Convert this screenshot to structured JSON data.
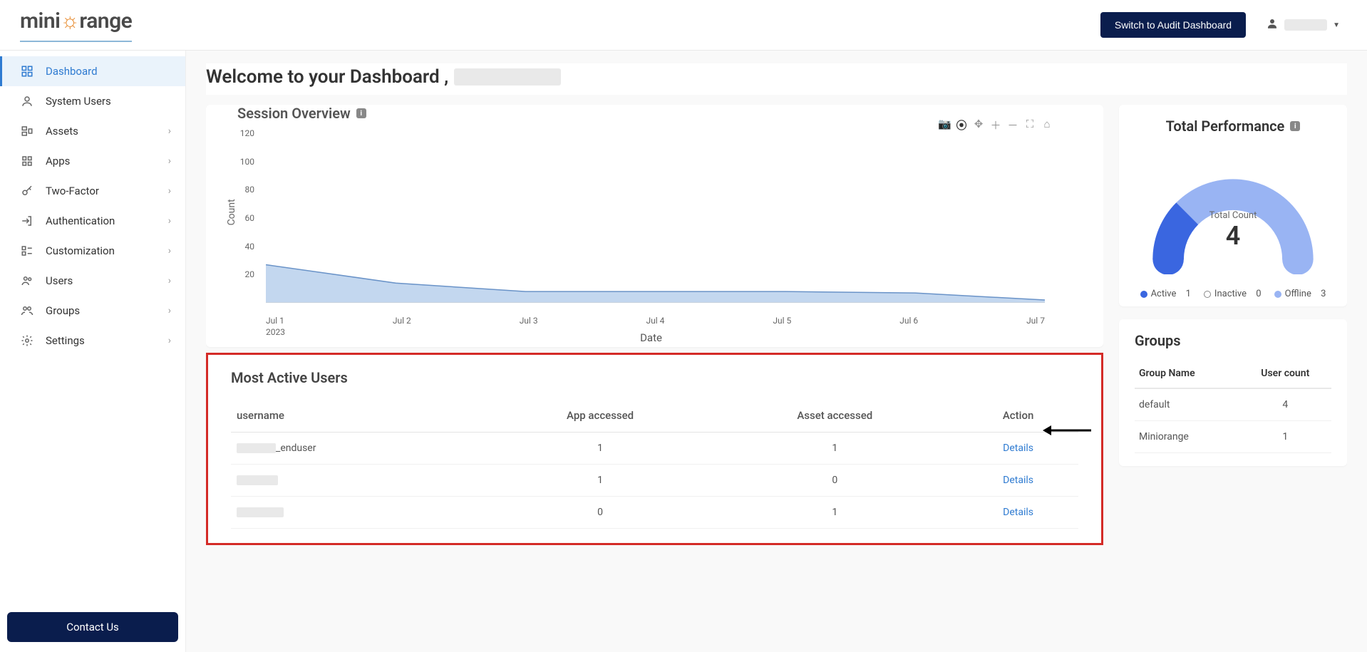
{
  "header": {
    "brand_prefix": "mini",
    "brand_suffix": "range",
    "switch_label": "Switch to Audit Dashboard"
  },
  "sidebar": {
    "items": [
      {
        "label": "Dashboard",
        "expandable": false,
        "active": true
      },
      {
        "label": "System Users",
        "expandable": false
      },
      {
        "label": "Assets",
        "expandable": true
      },
      {
        "label": "Apps",
        "expandable": true
      },
      {
        "label": "Two-Factor",
        "expandable": true
      },
      {
        "label": "Authentication",
        "expandable": true
      },
      {
        "label": "Customization",
        "expandable": true
      },
      {
        "label": "Users",
        "expandable": true
      },
      {
        "label": "Groups",
        "expandable": true
      },
      {
        "label": "Settings",
        "expandable": true
      }
    ],
    "contact": "Contact Us"
  },
  "welcome": {
    "text": "Welcome to your Dashboard ,"
  },
  "session": {
    "title": "Session Overview",
    "xlabel": "Date",
    "ylabel": "Count",
    "year": "2023"
  },
  "chart_data": {
    "type": "area",
    "title": "Session Overview",
    "xlabel": "Date",
    "ylabel": "Count",
    "ylim": [
      0,
      120
    ],
    "categories": [
      "Jul 1",
      "Jul 2",
      "Jul 3",
      "Jul 4",
      "Jul 5",
      "Jul 6",
      "Jul 7"
    ],
    "values": [
      27,
      14,
      8,
      8,
      8,
      7,
      2
    ],
    "year": "2023"
  },
  "active_users": {
    "title": "Most Active Users",
    "columns": [
      "username",
      "App accessed",
      "Asset accessed",
      "Action"
    ],
    "details_label": "Details",
    "rows": [
      {
        "username_suffix": "_enduser",
        "app": "1",
        "asset": "1"
      },
      {
        "username_suffix": "",
        "app": "1",
        "asset": "0"
      },
      {
        "username_suffix": "",
        "app": "0",
        "asset": "1"
      }
    ]
  },
  "performance": {
    "title": "Total Performance",
    "total_label": "Total Count",
    "total_value": "4",
    "legend": {
      "active": "Active",
      "inactive": "Inactive",
      "offline": "Offline"
    },
    "counts": {
      "active": "1",
      "inactive": "0",
      "offline": "3"
    }
  },
  "gauge_data": {
    "type": "gauge",
    "total": 4,
    "segments": [
      {
        "name": "Active",
        "value": 1,
        "color": "#3a66e0"
      },
      {
        "name": "Inactive",
        "value": 0,
        "color": "#ffffff"
      },
      {
        "name": "Offline",
        "value": 3,
        "color": "#99b4f3"
      }
    ]
  },
  "groups": {
    "title": "Groups",
    "columns": [
      "Group Name",
      "User count"
    ],
    "rows": [
      {
        "name": "default",
        "count": "4"
      },
      {
        "name": "Miniorange",
        "count": "1"
      }
    ]
  }
}
